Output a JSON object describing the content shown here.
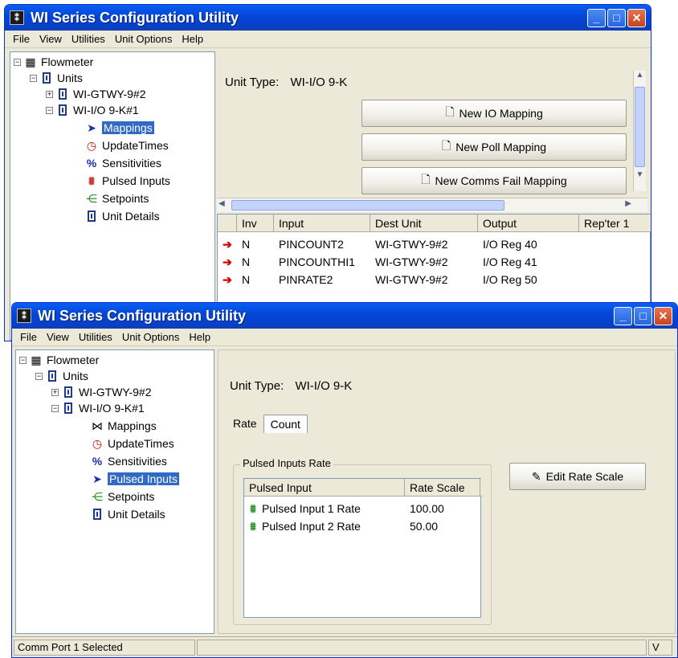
{
  "app_title": "WI Series Configuration Utility",
  "menu": [
    "File",
    "View",
    "Utilities",
    "Unit Options",
    "Help"
  ],
  "tree": {
    "root": "Flowmeter",
    "units": "Units",
    "unit1": "WI-GTWY-9#2",
    "unit2": "WI-I/O 9-K#1",
    "children": [
      "Mappings",
      "UpdateTimes",
      "Sensitivities",
      "Pulsed Inputs",
      "Setpoints",
      "Unit Details"
    ]
  },
  "window1": {
    "selected_node": "Mappings",
    "unit_type_label": "Unit Type:",
    "unit_type_value": "WI-I/O 9-K",
    "buttons": {
      "new_io": "New IO Mapping",
      "new_poll": "New Poll Mapping",
      "new_comms": "New Comms Fail Mapping"
    },
    "grid": {
      "headers": [
        "Inv",
        "Input",
        "Dest Unit",
        "Output",
        "Rep'ter 1"
      ],
      "rows": [
        {
          "inv": "N",
          "input": "PINCOUNT2",
          "dest": "WI-GTWY-9#2",
          "output": "I/O Reg 40"
        },
        {
          "inv": "N",
          "input": "PINCOUNTHI1",
          "dest": "WI-GTWY-9#2",
          "output": "I/O Reg 41"
        },
        {
          "inv": "N",
          "input": "PINRATE2",
          "dest": "WI-GTWY-9#2",
          "output": "I/O Reg 50"
        }
      ]
    }
  },
  "window2": {
    "selected_node": "Pulsed Inputs",
    "unit_type_label": "Unit Type:",
    "unit_type_value": "WI-I/O 9-K",
    "tabs": [
      "Rate",
      "Count"
    ],
    "group_title": "Pulsed Inputs Rate",
    "list_headers": [
      "Pulsed Input",
      "Rate Scale"
    ],
    "list_rows": [
      {
        "name": "Pulsed Input 1 Rate",
        "scale": "100.00"
      },
      {
        "name": "Pulsed Input 2 Rate",
        "scale": "50.00"
      }
    ],
    "edit_button": "Edit Rate Scale",
    "status_text": "Comm Port 1 Selected",
    "status_right": "V"
  },
  "colors": {
    "title_blue": "#0346d8",
    "selection": "#316ac5",
    "arrow_red": "#d40000"
  }
}
